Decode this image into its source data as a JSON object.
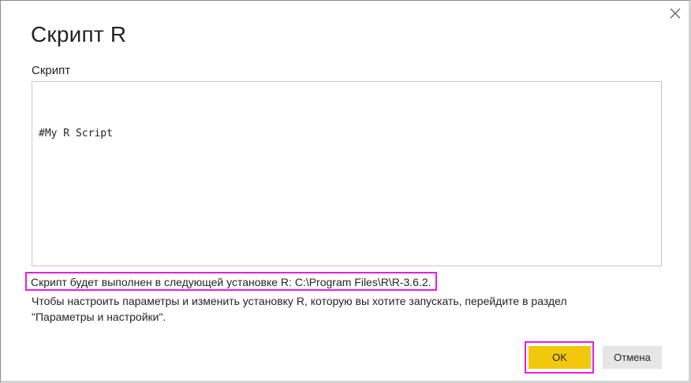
{
  "dialog": {
    "title": "Скрипт R",
    "close_icon": "close-icon"
  },
  "editor": {
    "label": "Скрипт",
    "content": "#My R Script"
  },
  "info": {
    "install_text": "Скрипт будет выполнен в следующей установке R: C:\\Program Files\\R\\R-3.6.2.",
    "settings_hint": "Чтобы настроить параметры и изменить установку R, которую вы хотите запускать, перейдите в раздел \"Параметры и настройки\".",
    "highlight_color": "#e81ce8"
  },
  "buttons": {
    "ok_label": "OK",
    "cancel_label": "Отмена",
    "ok_color": "#f2c80f",
    "cancel_color": "#e6e6e6"
  }
}
